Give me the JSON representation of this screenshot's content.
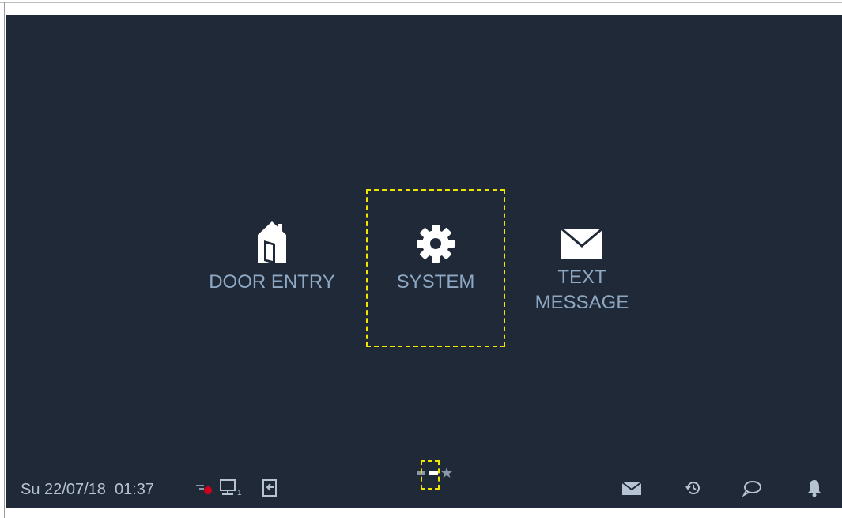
{
  "menu": {
    "door_entry": {
      "label": "DOOR ENTRY",
      "icon": "house-door-icon"
    },
    "system": {
      "label": "SYSTEM",
      "icon": "gear-icon",
      "selected": true
    },
    "text_message": {
      "label_line1": "TEXT",
      "label_line2": "MESSAGE",
      "icon": "envelope-icon"
    }
  },
  "pager": {
    "pages": 3,
    "current": 2,
    "icons": [
      "page-dot-icon",
      "page-dot-active-icon",
      "favorite-star-icon"
    ]
  },
  "status_bar": {
    "date": "Su 22/07/18",
    "time": "01:37",
    "left_icons": [
      "recording-indicator-icon",
      "monitor-1-icon",
      "exit-door-icon"
    ],
    "right_icons": [
      "mail-icon",
      "history-icon",
      "chat-bubble-icon",
      "bell-icon"
    ]
  },
  "colors": {
    "background": "#1f2937",
    "label": "#8fa9c4",
    "status_text": "#b6c3d3",
    "selection": "#f2e600",
    "recording": "#d0021b"
  }
}
